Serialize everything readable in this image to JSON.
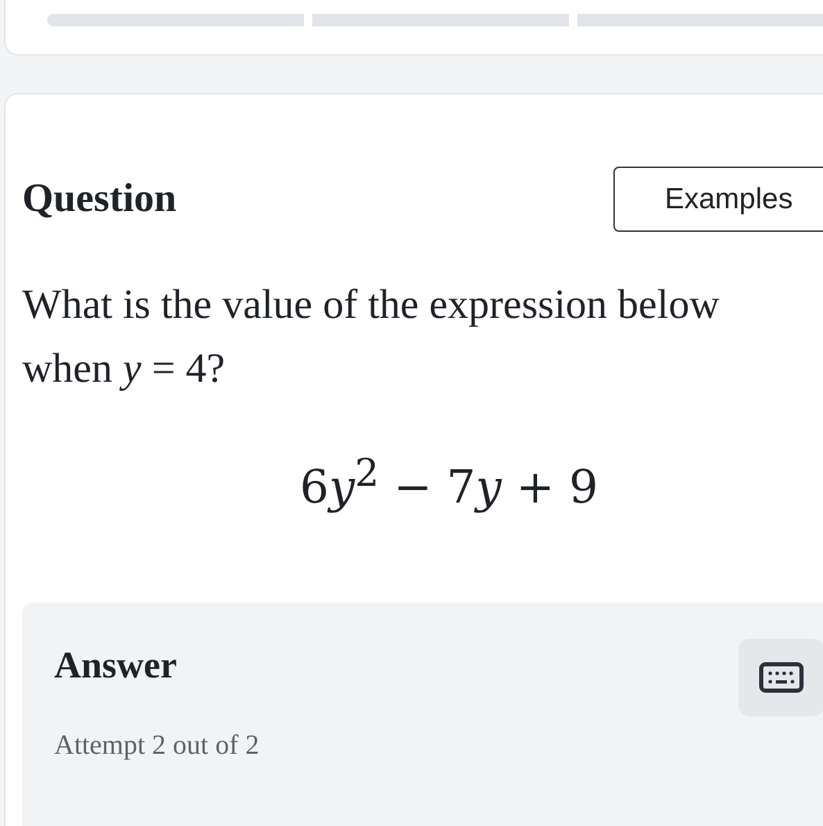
{
  "progress_segments": [
    {
      "level": 0
    },
    {
      "level": 0
    },
    {
      "level": 0
    }
  ],
  "question": {
    "title": "Question",
    "examples_button": "Examples",
    "prompt": "What is the value of the expression below when *y* = 4?",
    "expression": "6𝑦$^{2}$ − 7𝑦 + 9"
  },
  "answer": {
    "title": "Answer",
    "attempt": "Attempt 2 out of 2"
  }
}
